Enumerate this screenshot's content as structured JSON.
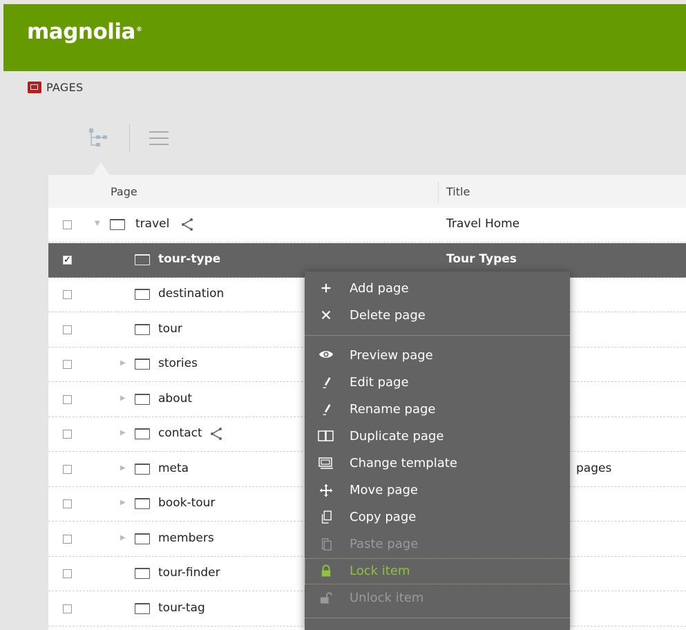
{
  "brand": {
    "name": "magnolia",
    "mark": "®"
  },
  "app": {
    "label": "PAGES",
    "icon": "pages-app-icon"
  },
  "view_toggles": [
    {
      "name": "tree-view",
      "icon": "tree-view-icon",
      "active": true
    },
    {
      "name": "list-view",
      "icon": "list-view-icon",
      "active": false
    }
  ],
  "grid": {
    "columns": {
      "page": "Page",
      "title": "Title"
    },
    "rows": [
      {
        "name": "travel",
        "title": "Travel Home",
        "checked": false,
        "expander": "expanded",
        "shared": true,
        "level": 0
      },
      {
        "name": "tour-type",
        "title": "Tour Types",
        "checked": true,
        "expander": "none",
        "shared": false,
        "level": 1
      },
      {
        "name": "destination",
        "title": "",
        "checked": false,
        "expander": "none",
        "shared": false,
        "level": 1
      },
      {
        "name": "tour",
        "title": "",
        "checked": false,
        "expander": "none",
        "shared": false,
        "level": 1
      },
      {
        "name": "stories",
        "title": "",
        "checked": false,
        "expander": "collapsed",
        "shared": false,
        "level": 1
      },
      {
        "name": "about",
        "title": "",
        "checked": false,
        "expander": "collapsed",
        "shared": false,
        "level": 1
      },
      {
        "name": "contact",
        "title": "",
        "checked": false,
        "expander": "collapsed",
        "shared": true,
        "level": 1
      },
      {
        "name": "meta",
        "title": "pages",
        "checked": false,
        "expander": "collapsed",
        "shared": false,
        "level": 1
      },
      {
        "name": "book-tour",
        "title": "",
        "checked": false,
        "expander": "collapsed",
        "shared": false,
        "level": 1
      },
      {
        "name": "members",
        "title": "",
        "checked": false,
        "expander": "collapsed",
        "shared": false,
        "level": 1
      },
      {
        "name": "tour-finder",
        "title": "",
        "checked": false,
        "expander": "none",
        "shared": false,
        "level": 1
      },
      {
        "name": "tour-tag",
        "title": "",
        "checked": false,
        "expander": "none",
        "shared": false,
        "level": 1
      }
    ]
  },
  "context_menu": {
    "groups": [
      [
        {
          "label": "Add page",
          "icon": "plus-icon",
          "state": "enabled"
        },
        {
          "label": "Delete page",
          "icon": "close-icon",
          "state": "enabled"
        }
      ],
      [
        {
          "label": "Preview page",
          "icon": "eye-icon",
          "state": "enabled"
        },
        {
          "label": "Edit page",
          "icon": "pencil-icon",
          "state": "enabled"
        },
        {
          "label": "Rename page",
          "icon": "pencil-icon",
          "state": "enabled"
        },
        {
          "label": "Duplicate page",
          "icon": "duplicate-icon",
          "state": "enabled"
        },
        {
          "label": "Change template",
          "icon": "template-icon",
          "state": "enabled"
        },
        {
          "label": "Move page",
          "icon": "move-icon",
          "state": "enabled"
        },
        {
          "label": "Copy page",
          "icon": "copy-icon",
          "state": "enabled"
        },
        {
          "label": "Paste page",
          "icon": "paste-icon",
          "state": "disabled"
        },
        {
          "label": "Lock item",
          "icon": "lock-icon",
          "state": "highlighted"
        },
        {
          "label": "Unlock item",
          "icon": "unlock-icon",
          "state": "disabled"
        }
      ]
    ]
  },
  "colors": {
    "brand_green": "#659a00",
    "app_icon_red": "#b3201d",
    "selection_gray": "#636363",
    "lock_green": "#8fc33a"
  }
}
